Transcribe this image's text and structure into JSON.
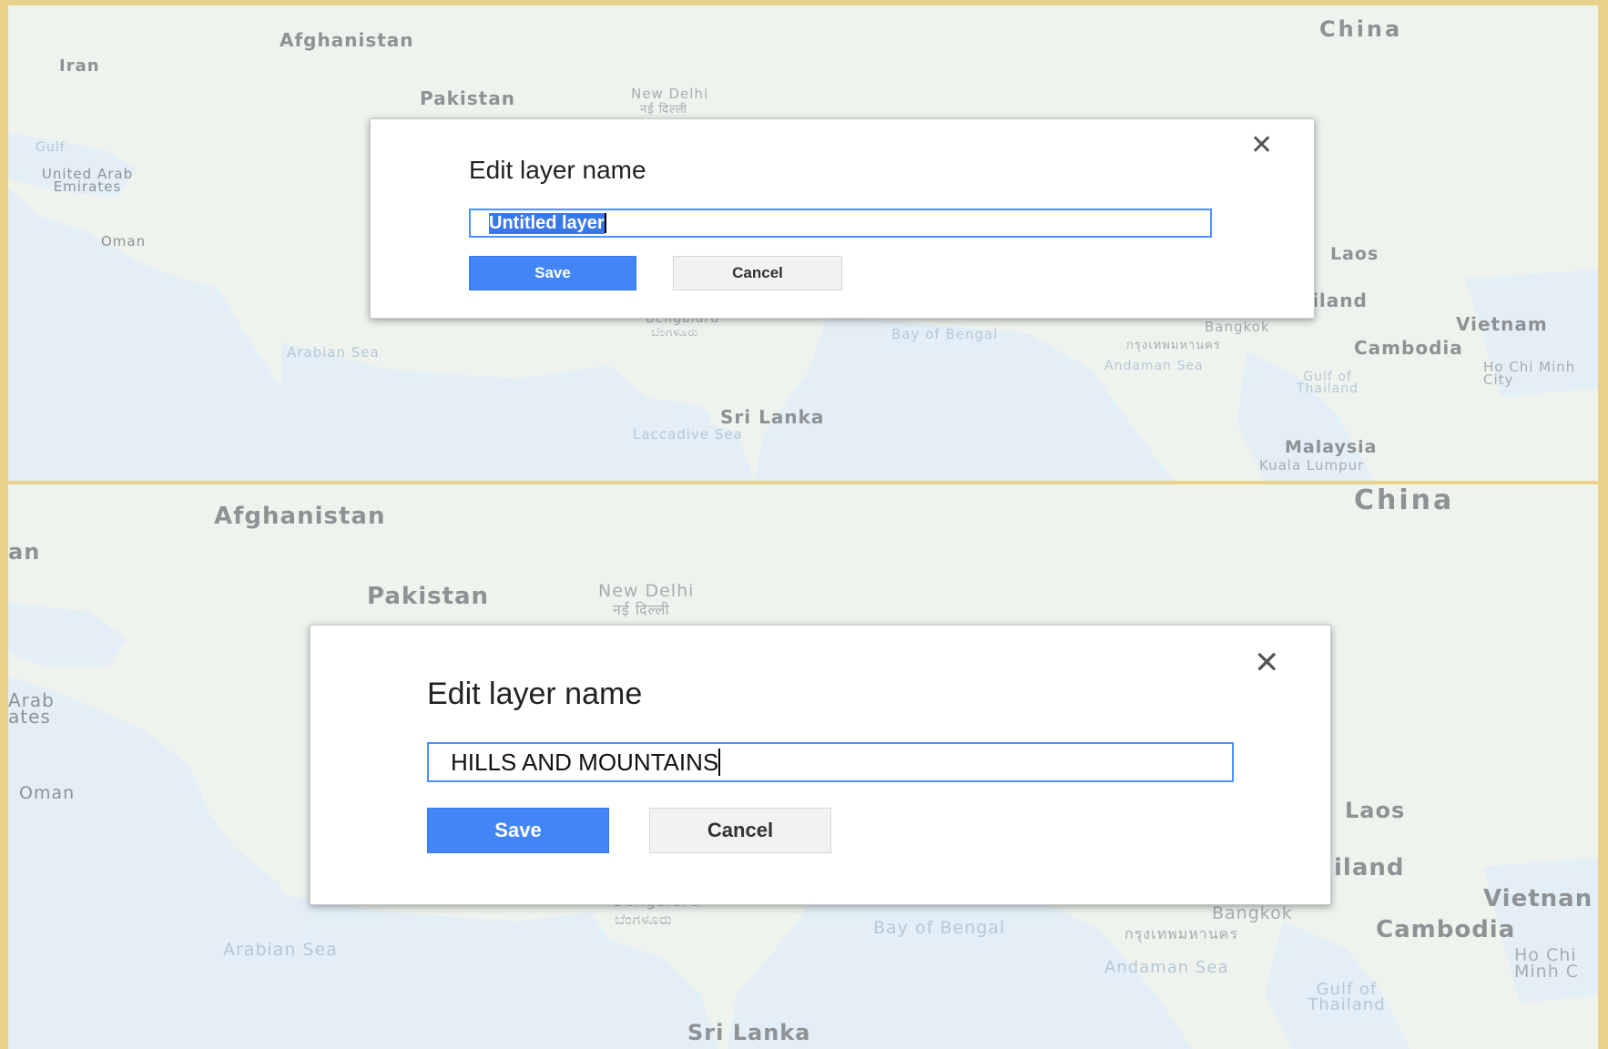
{
  "map": {
    "countries": {
      "afghanistan": "Afghanistan",
      "iran": "Iran",
      "pakistan": "Pakistan",
      "china": "China",
      "laos": "Laos",
      "thailand_partial": "iland",
      "vietnam": "Vietnam",
      "vietnam_partial": "Vietnan",
      "cambodia": "Cambodia",
      "sri_lanka": "Sri Lanka",
      "malaysia": "Malaysia",
      "oman": "Oman",
      "uae": "United Arab Emirates",
      "uae_partial": "Arab ates",
      "iran_partial": "an"
    },
    "cities": {
      "new_delhi": "New Delhi",
      "new_delhi_hindi": "नई दिल्ली",
      "bengaluru": "Bengaluru",
      "bengaluru_kannada": "ಬೆಂಗಳೂರು",
      "bangkok": "Bangkok",
      "bangkok_thai": "กรุงเทพมหานคร",
      "ho_chi_minh": "Ho Chi Minh City",
      "ho_chi_minh_partial": "Ho Chi Minh C",
      "kuala_lumpur": "Kuala Lumpur"
    },
    "waters": {
      "gulf": "Gulf",
      "arabian_sea": "Arabian Sea",
      "bay_of_bengal": "Bay of Bengal",
      "andaman_sea": "Andaman Sea",
      "gulf_of_thailand": "Gulf of Thailand",
      "laccadive_sea": "Laccadive Sea"
    }
  },
  "dialog_top": {
    "title": "Edit layer name",
    "input_value": "Untitled layer",
    "save_label": "Save",
    "cancel_label": "Cancel"
  },
  "dialog_bottom": {
    "title": "Edit layer name",
    "input_value": "HILLS AND MOUNTAINS",
    "save_label": "Save",
    "cancel_label": "Cancel"
  },
  "icons": {
    "close": "close-icon"
  },
  "colors": {
    "frame": "#e9d28a",
    "land": "#eef3ee",
    "water": "#e3eef6",
    "save_button": "#4285f4",
    "input_border": "#4d90fe",
    "selection": "#3b78e7"
  }
}
